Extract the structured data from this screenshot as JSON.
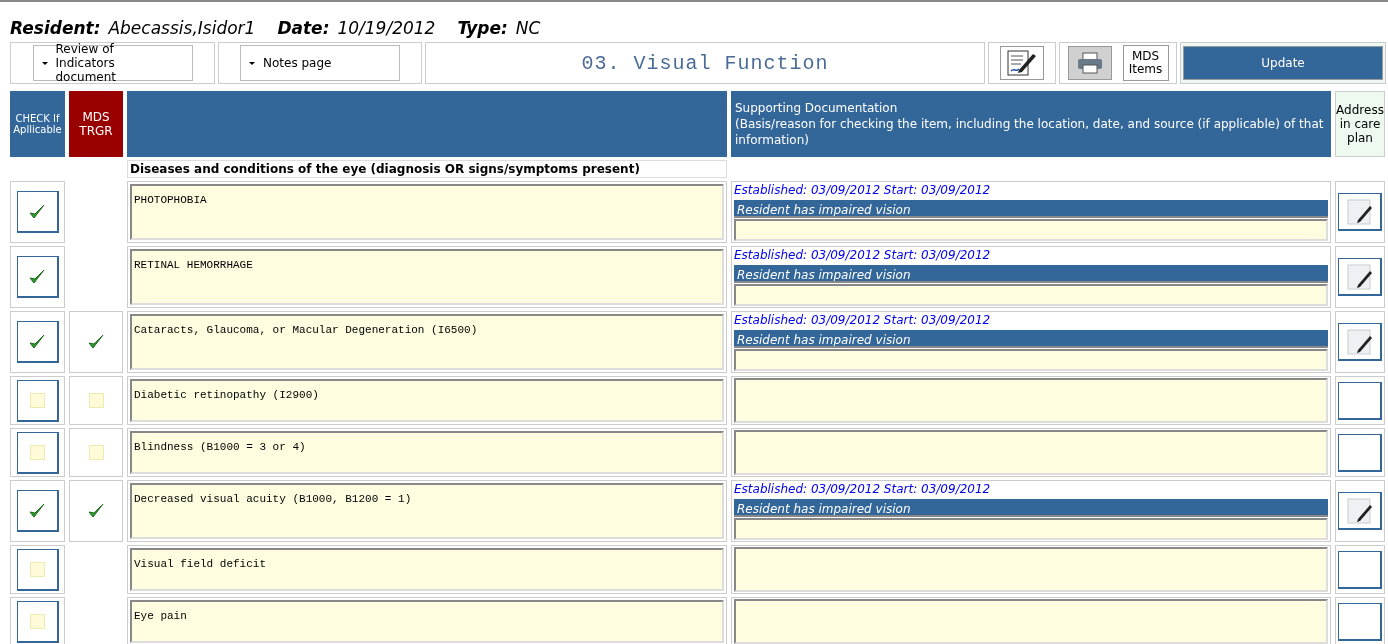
{
  "header": {
    "resident_label": "Resident:",
    "resident": "Abecassis,Isidor1",
    "date_label": "Date:",
    "date": "10/19/2012",
    "type_label": "Type:",
    "type": "NC"
  },
  "toolbar": {
    "review_menu": "Review of Indicators document",
    "notes_menu": "Notes page",
    "section_title": "03. Visual Function",
    "mds_items": "MDS Items",
    "update": "Update"
  },
  "columns": {
    "check": "CHECK If Apllicable",
    "trigger": "MDS TRGR",
    "documentation_title": "Supporting Documentation",
    "documentation_hint": "(Basis/reason for checking the item, including the location, date, and source (if applicable) of that information)",
    "care_plan": "Address in care plan"
  },
  "group_title": "Diseases and conditions of the eye (diagnosis OR signs/symptoms present)",
  "rows": [
    {
      "text": "PHOTOPHOBIA",
      "checked": true,
      "trigger": null,
      "care_plan": true,
      "documentation": {
        "established": "Established: 03/09/2012  Start: 03/09/2012",
        "reason": "Resident has impaired vision"
      }
    },
    {
      "text": "RETINAL HEMORRHAGE",
      "checked": true,
      "trigger": null,
      "care_plan": true,
      "documentation": {
        "established": "Established: 03/09/2012  Start: 03/09/2012",
        "reason": "Resident has impaired vision"
      }
    },
    {
      "text": "Cataracts, Glaucoma, or Macular Degeneration (I6500)",
      "checked": true,
      "trigger": {
        "checked": true
      },
      "care_plan": true,
      "documentation": {
        "established": "Established: 03/09/2012  Start: 03/09/2012",
        "reason": "Resident has impaired vision"
      }
    },
    {
      "text": "Diabetic retinopathy (I2900)",
      "checked": false,
      "trigger": {
        "checked": false
      },
      "care_plan": false,
      "documentation": null
    },
    {
      "text": "Blindness (B1000 = 3 or 4)",
      "checked": false,
      "trigger": {
        "checked": false
      },
      "care_plan": false,
      "documentation": null
    },
    {
      "text": "Decreased visual acuity (B1000, B1200 = 1)",
      "checked": true,
      "trigger": {
        "checked": true
      },
      "care_plan": true,
      "documentation": {
        "established": "Established: 03/09/2012  Start: 03/09/2012",
        "reason": "Resident has impaired vision"
      }
    },
    {
      "text": "Visual field deficit",
      "checked": false,
      "trigger": null,
      "care_plan": false,
      "documentation": null
    },
    {
      "text": "Eye pain",
      "checked": false,
      "trigger": null,
      "care_plan": false,
      "documentation": null
    }
  ]
}
